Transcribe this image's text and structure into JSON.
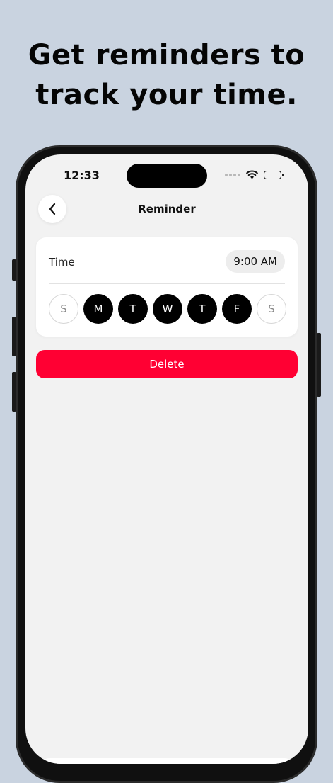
{
  "promo": {
    "line1": "Get reminders to",
    "line2": "track your time."
  },
  "status_bar": {
    "time": "12:33",
    "icons": [
      "signal-icon",
      "wifi-icon",
      "battery-icon"
    ]
  },
  "nav": {
    "title": "Reminder",
    "back_icon": "chevron-left-icon"
  },
  "reminder": {
    "time_label": "Time",
    "time_value": "9:00 AM",
    "days": [
      {
        "label": "S",
        "selected": false
      },
      {
        "label": "M",
        "selected": true
      },
      {
        "label": "T",
        "selected": true
      },
      {
        "label": "W",
        "selected": true
      },
      {
        "label": "T",
        "selected": true
      },
      {
        "label": "F",
        "selected": true
      },
      {
        "label": "S",
        "selected": false
      }
    ]
  },
  "actions": {
    "delete_label": "Delete"
  },
  "colors": {
    "delete": "#ff0033",
    "day_selected": "#000000",
    "background": "#c9d3e0"
  }
}
